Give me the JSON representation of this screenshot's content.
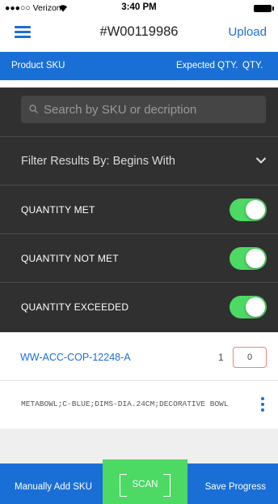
{
  "status_bar": {
    "carrier": "●●●○○ Verizon",
    "time": "3:40 PM"
  },
  "nav": {
    "title": "#W00119986",
    "upload_label": "Upload",
    "menu_icon": "hamburger-menu-icon"
  },
  "table_header": {
    "sku": "Product SKU",
    "expected_qty": "Expected QTY.",
    "qty": "QTY."
  },
  "filter_panel": {
    "search_placeholder": "Search by SKU or decription",
    "filter_by_label": "Filter Results By: Begins With",
    "toggles": [
      {
        "label": "QUANTITY MET",
        "on": true
      },
      {
        "label": "QUANTITY NOT MET",
        "on": true
      },
      {
        "label": "QUANTITY EXCEEDED",
        "on": true
      }
    ]
  },
  "items": [
    {
      "sku": "WW-ACC-COP-12248-A",
      "expected_qty": "1",
      "qty": "0",
      "description": "METABOWL;C-BLUE;DIMS-DIA.24CM;DECORATIVE BOWL"
    }
  ],
  "bottom_bar": {
    "manual_add_label": "Manually Add SKU",
    "scan_label": "SCAN",
    "save_label": "Save Progress"
  },
  "colors": {
    "primary_blue": "#1a6fd6",
    "toggle_green": "#4cd964",
    "panel_dark": "#303030",
    "qty_border": "#e88686"
  }
}
